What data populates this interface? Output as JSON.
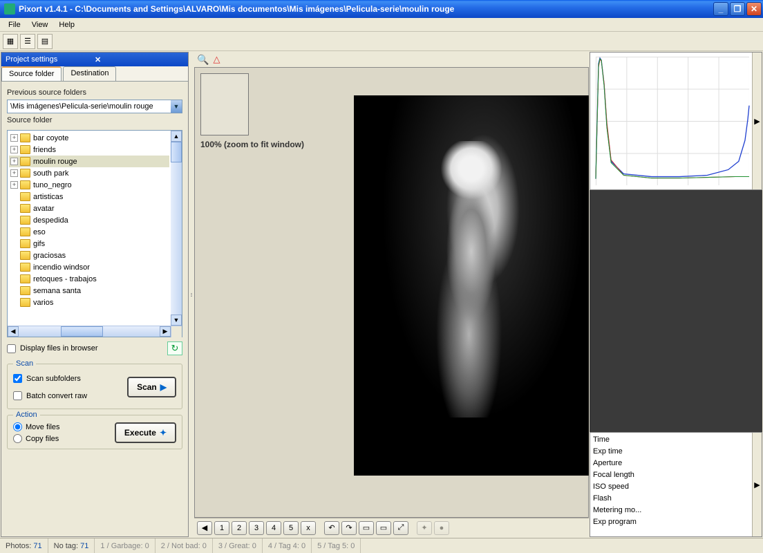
{
  "window": {
    "title": "Pixort v1.4.1 - C:\\Documents and Settings\\ALVARO\\Mis documentos\\Mis imágenes\\Pelicula-serie\\moulin rouge",
    "buttons": {
      "min": "_",
      "max": "❐",
      "close": "✕"
    }
  },
  "menu": {
    "file": "File",
    "view": "View",
    "help": "Help"
  },
  "panel": {
    "title": "Project settings",
    "tabs": {
      "source": "Source folder",
      "dest": "Destination"
    },
    "prev_label": "Previous source folders",
    "prev_value": "\\Mis imágenes\\Pelicula-serie\\moulin rouge",
    "source_label": "Source folder",
    "tree": [
      {
        "name": "bar coyote",
        "exp": true
      },
      {
        "name": "friends",
        "exp": true
      },
      {
        "name": "moulin rouge",
        "exp": true,
        "selected": true
      },
      {
        "name": "south park",
        "exp": true
      },
      {
        "name": "tuno_negro",
        "exp": true
      },
      {
        "name": "artisticas"
      },
      {
        "name": "avatar"
      },
      {
        "name": "despedida"
      },
      {
        "name": "eso"
      },
      {
        "name": "gifs"
      },
      {
        "name": "graciosas"
      },
      {
        "name": "incendio windsor"
      },
      {
        "name": "retoques - trabajos"
      },
      {
        "name": "semana santa"
      },
      {
        "name": "varios"
      }
    ],
    "display_files": "Display files in browser",
    "scan": {
      "legend": "Scan",
      "subfolders": "Scan subfolders",
      "batch": "Batch convert raw",
      "button": "Scan"
    },
    "action": {
      "legend": "Action",
      "move": "Move files",
      "copy": "Copy files",
      "button": "Execute"
    }
  },
  "center": {
    "zoom_text": "100% (zoom to fit window)",
    "buttons": {
      "nums": [
        "1",
        "2",
        "3",
        "4",
        "5"
      ],
      "x": "x",
      "rot_l": "↶",
      "rot_r": "↷",
      "rect": "▭",
      "wide": "▭",
      "expand": "⤢",
      "blob1": "✦",
      "blob2": "●"
    }
  },
  "exif": {
    "items": [
      "Time",
      "Exp time",
      "Aperture",
      "Focal length",
      "ISO speed",
      "Flash",
      "Metering mo...",
      "Exp program"
    ]
  },
  "status": {
    "photos_l": "Photos:",
    "photos_v": "71",
    "notag_l": "No tag:",
    "notag_v": "71",
    "garbage_l": "1 / Garbage:",
    "garbage_v": "0",
    "notbad_l": "2 / Not bad:",
    "notbad_v": "0",
    "great_l": "3 / Great:",
    "great_v": "0",
    "tag4_l": "4 / Tag 4:",
    "tag4_v": "0",
    "tag5_l": "5 / Tag 5:",
    "tag5_v": "0"
  }
}
